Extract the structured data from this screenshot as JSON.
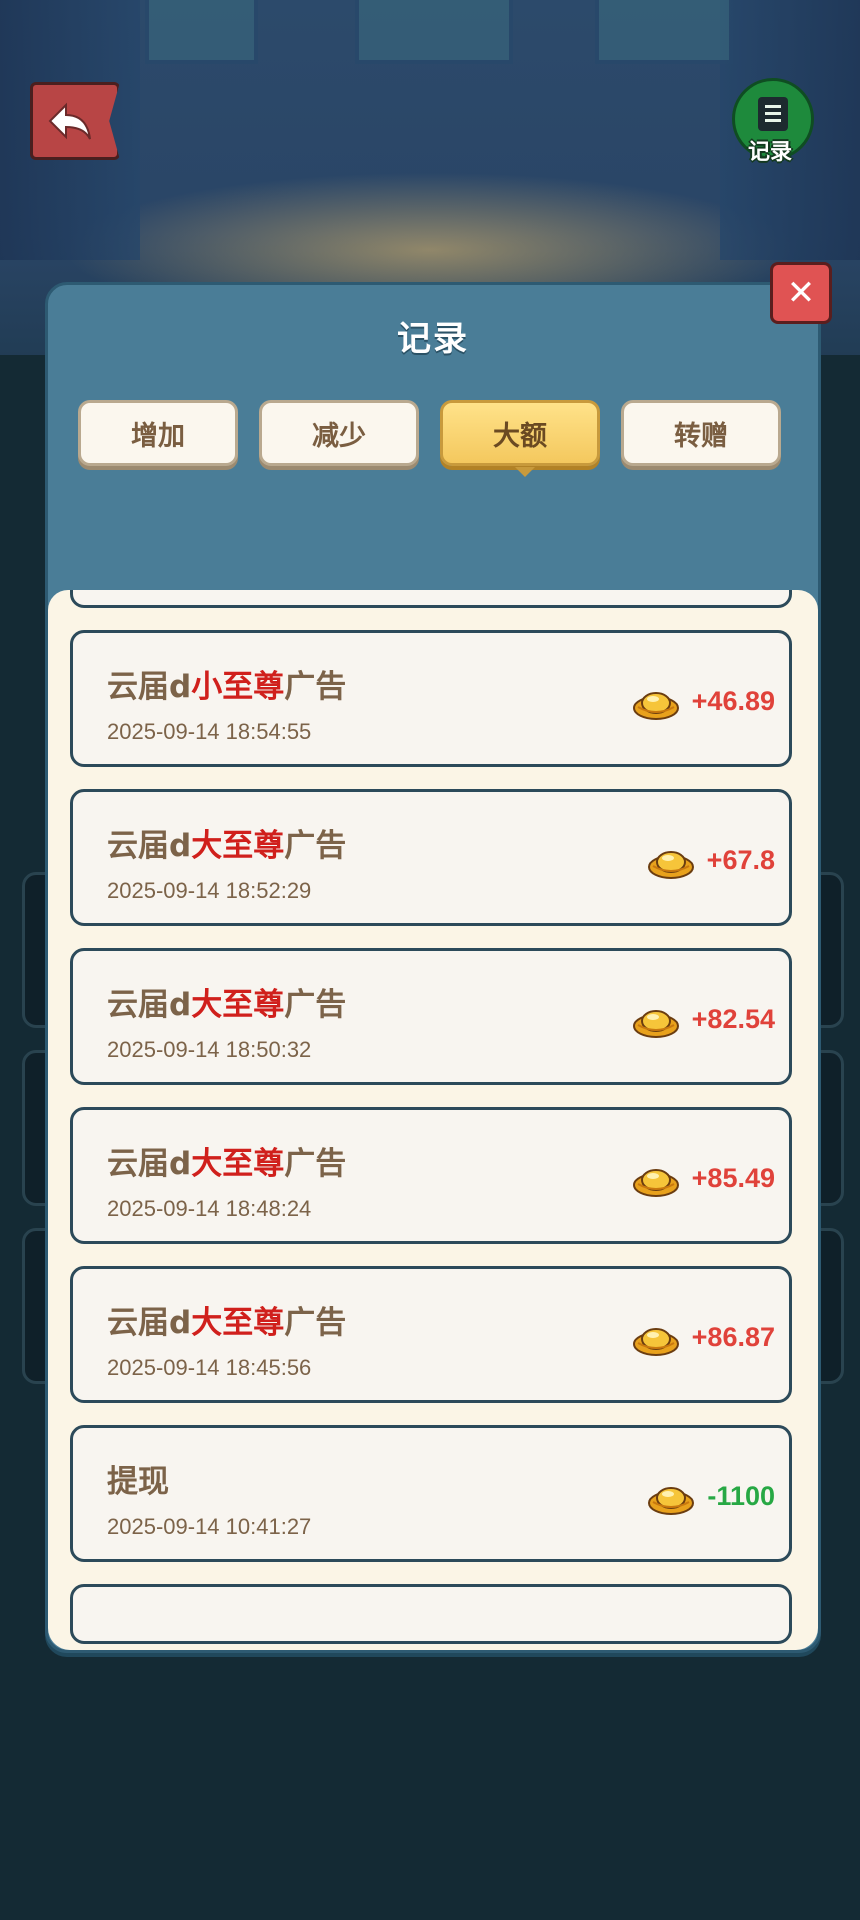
{
  "top_bar": {
    "record_label": "记录"
  },
  "modal": {
    "title": "记录",
    "close_symbol": "✕",
    "tabs": [
      {
        "label": "增加",
        "active": false
      },
      {
        "label": "减少",
        "active": false
      },
      {
        "label": "大额",
        "active": true
      },
      {
        "label": "转赠",
        "active": false
      }
    ],
    "records": [
      {
        "title_prefix": "云届d",
        "title_highlight": "小至尊",
        "title_suffix": "广告",
        "time": "2025-09-14 18:54:55",
        "amount": "+46.89"
      },
      {
        "title_prefix": "云届d",
        "title_highlight": "大至尊",
        "title_suffix": "广告",
        "time": "2025-09-14 18:52:29",
        "amount": "+67.8"
      },
      {
        "title_prefix": "云届d",
        "title_highlight": "大至尊",
        "title_suffix": "广告",
        "time": "2025-09-14 18:50:32",
        "amount": "+82.54"
      },
      {
        "title_prefix": "云届d",
        "title_highlight": "大至尊",
        "title_suffix": "广告",
        "time": "2025-09-14 18:48:24",
        "amount": "+85.49"
      },
      {
        "title_prefix": "云届d",
        "title_highlight": "大至尊",
        "title_suffix": "广告",
        "time": "2025-09-14 18:45:56",
        "amount": "+86.87"
      },
      {
        "title_prefix": "提现",
        "title_highlight": "",
        "title_suffix": "",
        "time": "2025-09-14 10:41:27",
        "amount": "-1100"
      }
    ]
  },
  "icons": {
    "back": "back-arrow-icon",
    "record": "document-icon",
    "close": "close-icon",
    "currency": "gold-ingot-icon"
  },
  "colors": {
    "positive_amount": "#e0423a",
    "negative_amount": "#27a844",
    "highlight_text": "#d0201c",
    "active_tab": "#f4c85e",
    "modal_header": "#4a7d97"
  }
}
